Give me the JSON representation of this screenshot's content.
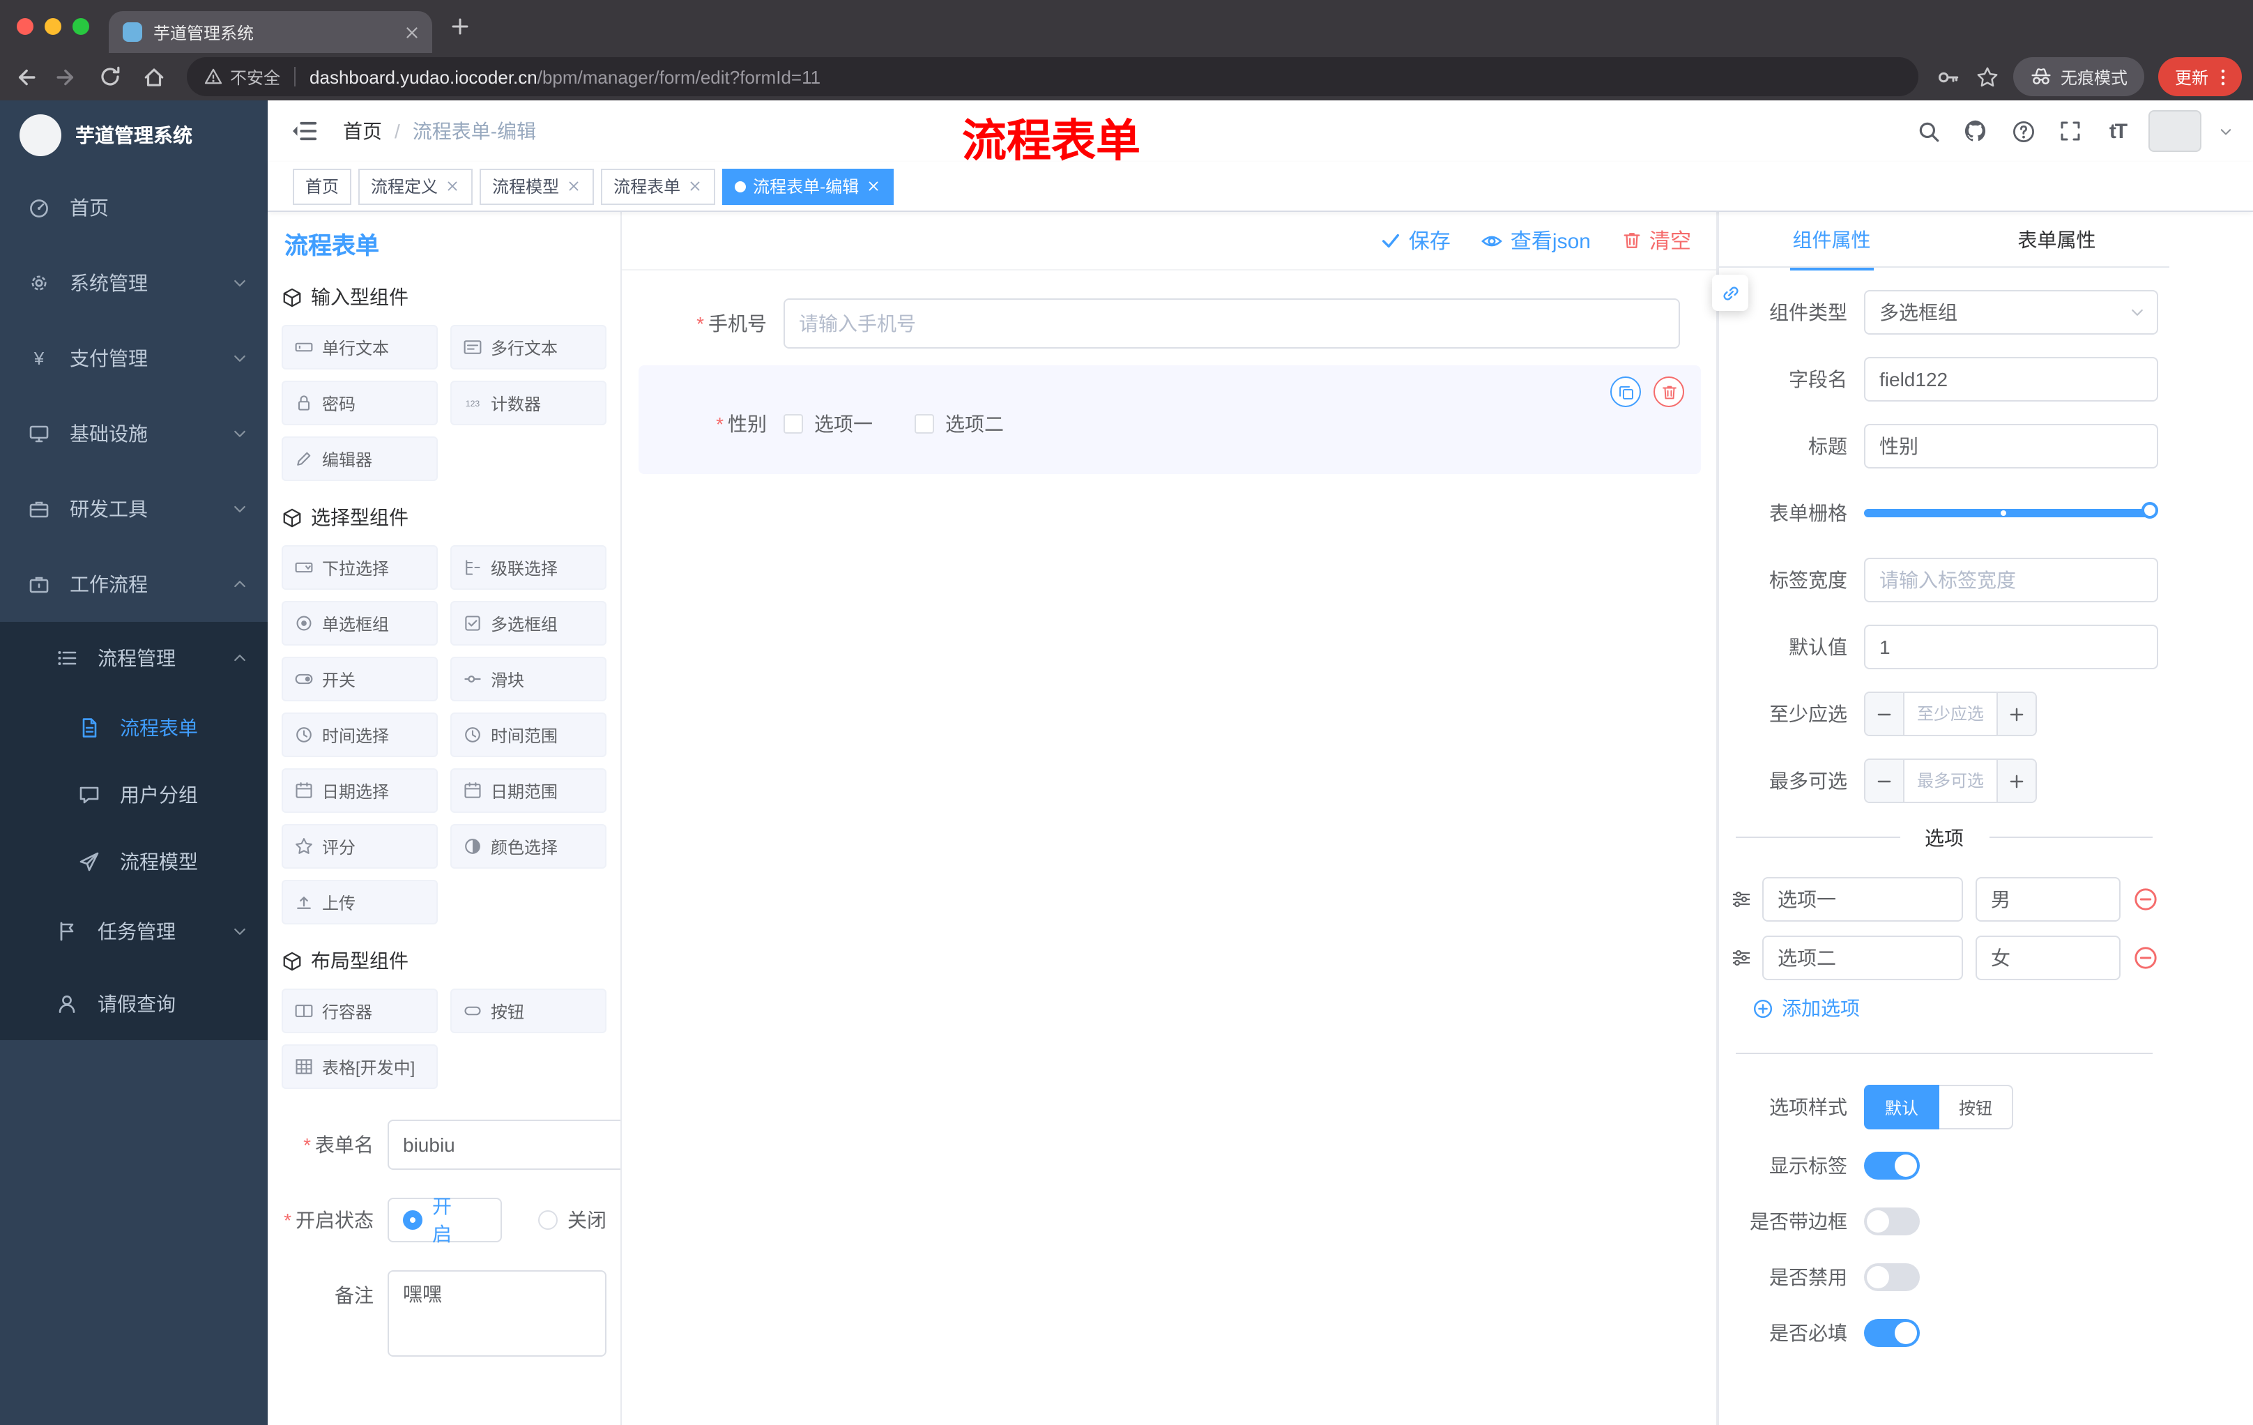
{
  "ui": {
    "required_mark": "*"
  },
  "colors": {
    "primary": "#409EFF",
    "danger": "#F56C6C",
    "sidebar_bg": "#304156",
    "submenu_bg": "#1F2D3D",
    "active_tag_bg": "#409EFF",
    "update_button_bg": "#E1453B",
    "annotation_red": "#FF0000",
    "selected_item_bg": "#F6F7FF"
  },
  "browser": {
    "tab": {
      "title": "芋道管理系统"
    },
    "address": {
      "security_label": "不安全",
      "host": "dashboard.yudao.iocoder.cn",
      "path": "/bpm/manager/form/edit?formId=11"
    },
    "incognito_label": "无痕模式",
    "update_label": "更新"
  },
  "app_header": {
    "breadcrumb": {
      "root": "首页",
      "separator": "/",
      "current": "流程表单-编辑"
    },
    "annotation": "流程表单",
    "font_size_icon_text": "tT"
  },
  "sidebar": {
    "logo_title": "芋道管理系统",
    "items": [
      {
        "label": "首页"
      },
      {
        "label": "系统管理"
      },
      {
        "label": "支付管理"
      },
      {
        "label": "基础设施"
      },
      {
        "label": "研发工具"
      },
      {
        "label": "工作流程"
      },
      {
        "label": "流程管理"
      },
      {
        "label": "流程表单",
        "active": true
      },
      {
        "label": "用户分组"
      },
      {
        "label": "流程模型"
      },
      {
        "label": "任务管理"
      },
      {
        "label": "请假查询"
      }
    ]
  },
  "tags": [
    {
      "label": "首页"
    },
    {
      "label": "流程定义",
      "closable": true
    },
    {
      "label": "流程模型",
      "closable": true
    },
    {
      "label": "流程表单",
      "closable": true
    },
    {
      "label": "流程表单-编辑",
      "closable": true,
      "active": true
    }
  ],
  "palette": {
    "title": "流程表单",
    "groups": [
      {
        "title": "输入型组件",
        "items": [
          "单行文本",
          "多行文本",
          "密码",
          "计数器",
          "编辑器"
        ]
      },
      {
        "title": "选择型组件",
        "items": [
          "下拉选择",
          "级联选择",
          "单选框组",
          "多选框组",
          "开关",
          "滑块",
          "时间选择",
          "时间范围",
          "日期选择",
          "日期范围",
          "评分",
          "颜色选择",
          "上传"
        ]
      },
      {
        "title": "布局型组件",
        "items": [
          "行容器",
          "按钮",
          "表格[开发中]"
        ]
      }
    ],
    "form": {
      "name_label": "表单名",
      "name_value": "biubiu",
      "status_label": "开启状态",
      "status_on": "开启",
      "status_off": "关闭",
      "remark_label": "备注",
      "remark_value": "嘿嘿"
    }
  },
  "canvas": {
    "actions": {
      "save": "保存",
      "view_json": "查看json",
      "clear": "清空"
    },
    "phone_field": {
      "label": "手机号",
      "placeholder": "请输入手机号"
    },
    "gender_field": {
      "label": "性别",
      "options": [
        "选项一",
        "选项二"
      ]
    }
  },
  "properties": {
    "tabs": [
      "组件属性",
      "表单属性"
    ],
    "rows": {
      "component_type": {
        "label": "组件类型",
        "value": "多选框组"
      },
      "field_name": {
        "label": "字段名",
        "value": "field122"
      },
      "title": {
        "label": "标题",
        "value": "性别"
      },
      "form_grid": {
        "label": "表单栅格"
      },
      "label_width": {
        "label": "标签宽度",
        "placeholder": "请输入标签宽度"
      },
      "default_value": {
        "label": "默认值",
        "value": "1"
      },
      "min_select": {
        "label": "至少应选",
        "placeholder": "至少应选"
      },
      "max_select": {
        "label": "最多可选",
        "placeholder": "最多可选"
      }
    },
    "options_section": {
      "divider": "选项",
      "options": [
        {
          "label": "选项一",
          "value": "男"
        },
        {
          "label": "选项二",
          "value": "女"
        }
      ],
      "add_label": "添加选项"
    },
    "option_style": {
      "label": "选项样式",
      "choices": [
        "默认",
        "按钮"
      ],
      "selected": "默认"
    },
    "switches": [
      {
        "label": "显示标签",
        "on": true
      },
      {
        "label": "是否带边框",
        "on": false
      },
      {
        "label": "是否禁用",
        "on": false
      },
      {
        "label": "是否必填",
        "on": true
      }
    ]
  }
}
